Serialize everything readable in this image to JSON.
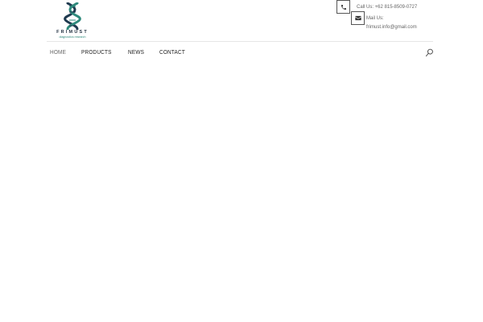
{
  "brand": {
    "name": "FRIMUST",
    "tagline": "diagnostics research"
  },
  "contact": {
    "call_label": "Call Us: +62 815-8509-0727",
    "mail_label": "Mail Us:",
    "mail_value": "frimust.info@gmail.com",
    "icons": [
      "phone-icon",
      "envelope-icon"
    ]
  },
  "nav": {
    "items": [
      {
        "label": "HOME",
        "active": true
      },
      {
        "label": "PRODUCTS",
        "active": false
      },
      {
        "label": "NEWS",
        "active": false
      },
      {
        "label": "CONTACT",
        "active": false
      }
    ],
    "search_icon": "search-icon"
  },
  "colors": {
    "accent_teal": "#2f8a7c",
    "accent_navy": "#1f2f3f",
    "text_dark": "#222222",
    "divider": "#e6e6e6"
  }
}
